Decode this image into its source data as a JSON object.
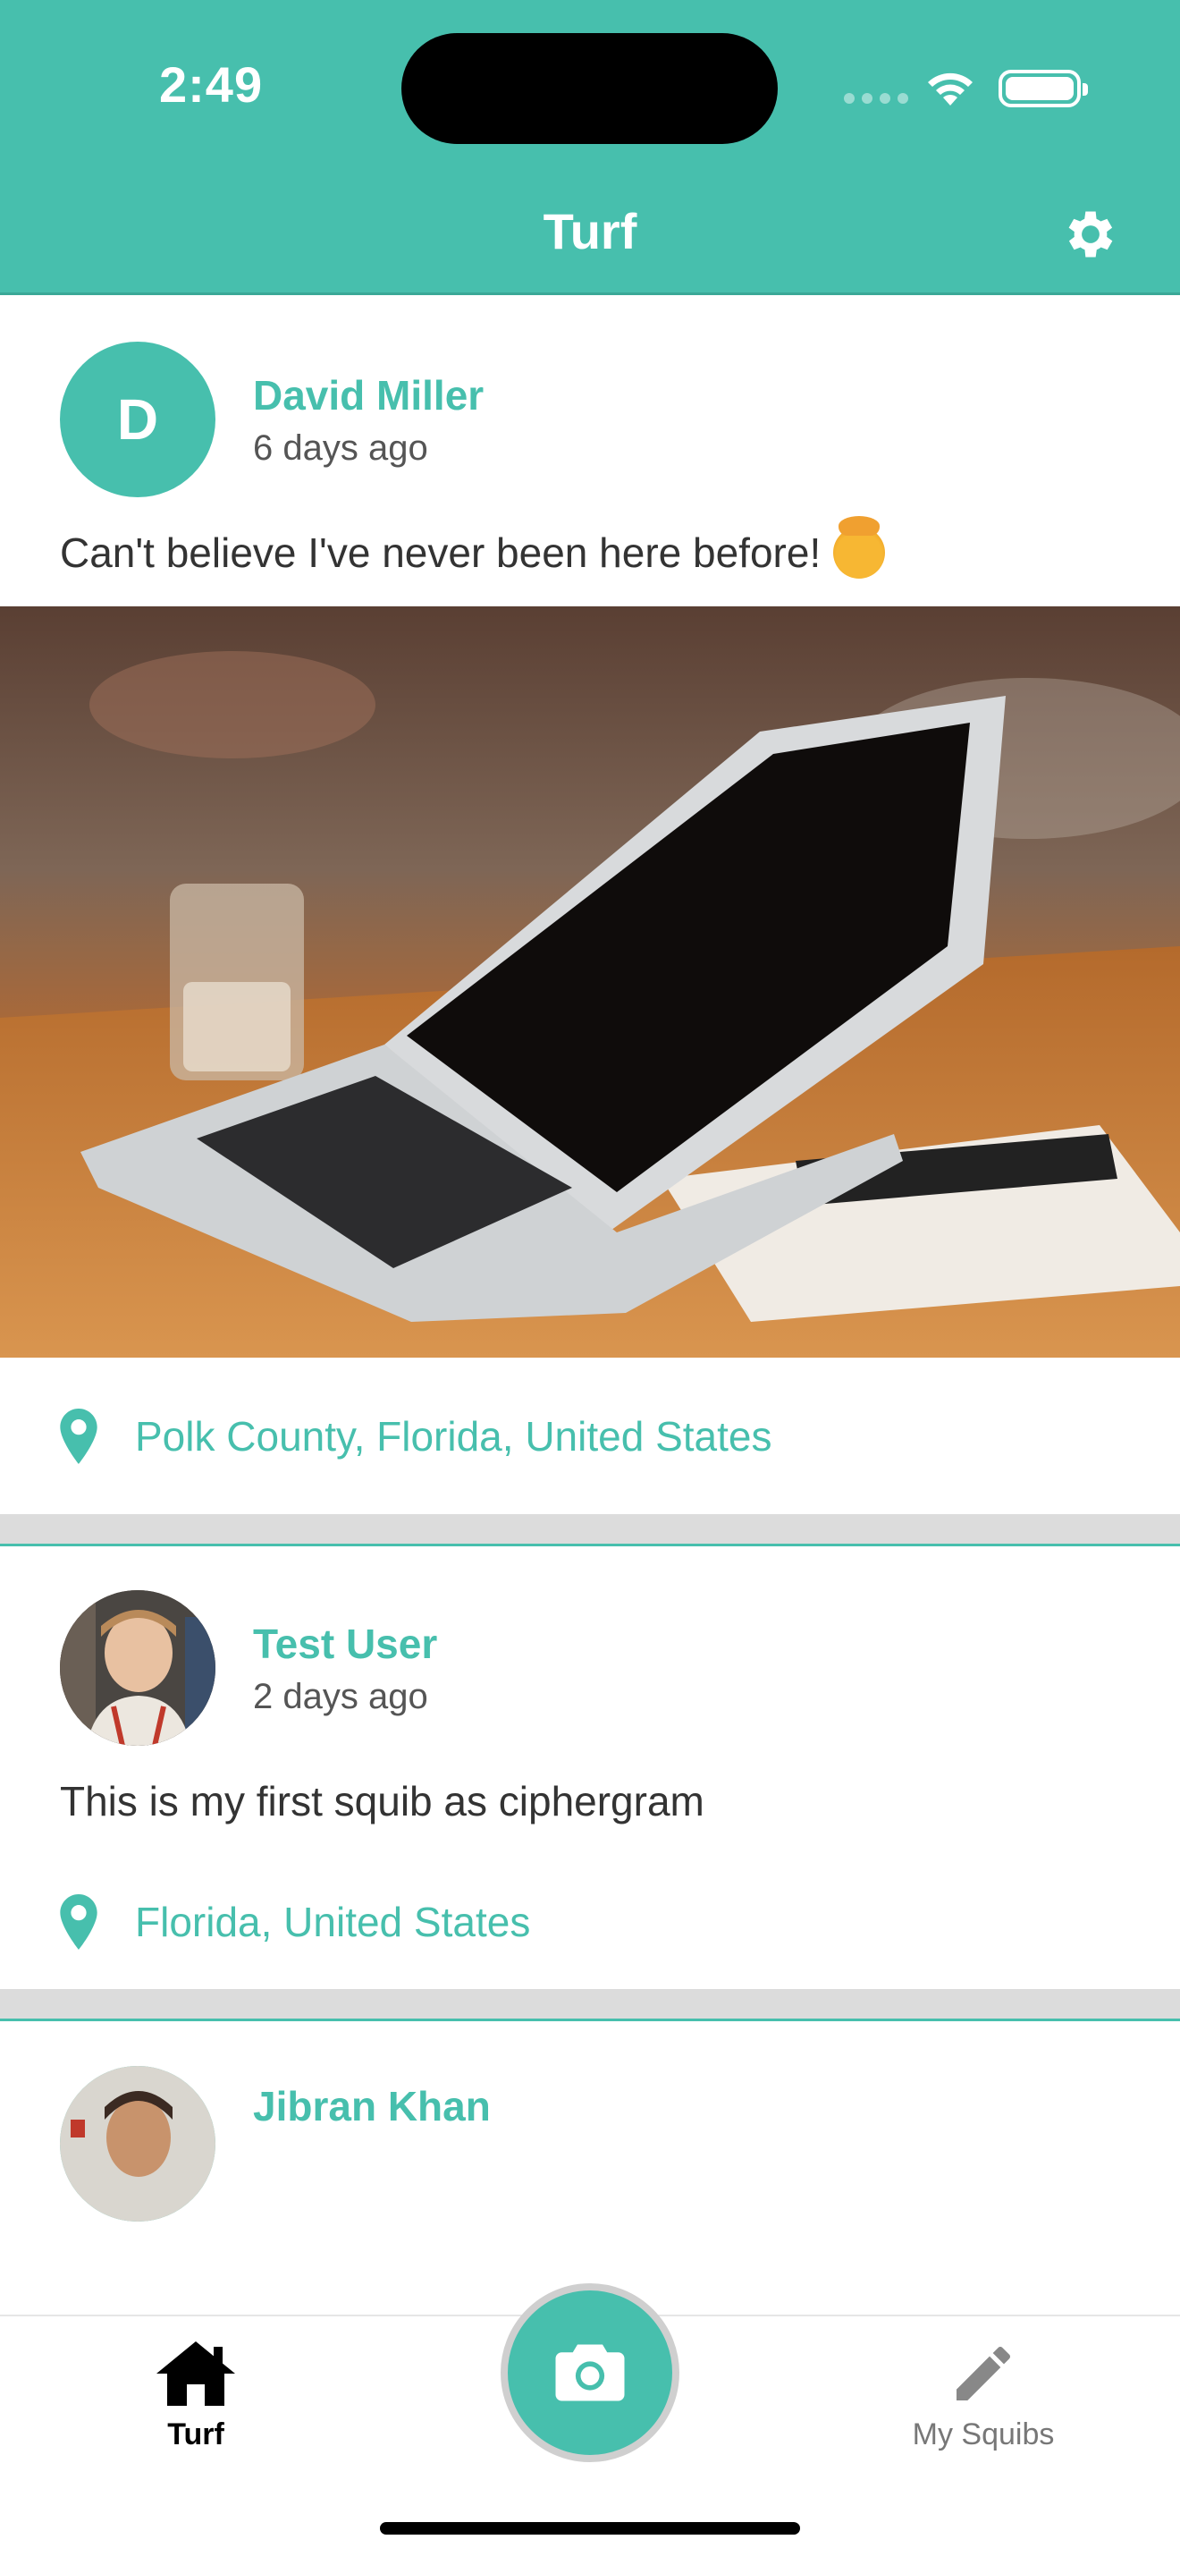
{
  "status_bar": {
    "time": "2:49"
  },
  "nav": {
    "title": "Turf"
  },
  "posts": [
    {
      "author": "David Miller",
      "avatar_initial": "D",
      "time_ago": "6 days ago",
      "text": "Can't believe I've never been here before!",
      "emoji": "exploding-head",
      "has_image": true,
      "location": "Polk County, Florida, United States"
    },
    {
      "author": "Test User",
      "avatar_initial": "",
      "time_ago": "2 days ago",
      "text": "This is my first squib as ciphergram",
      "has_image": false,
      "location": "Florida, United States"
    },
    {
      "author": "Jibran Khan",
      "avatar_initial": "",
      "time_ago": "",
      "text": ""
    }
  ],
  "tabs": {
    "turf": "Turf",
    "my_squibs": "My Squibs"
  },
  "colors": {
    "accent": "#47bfad",
    "inactive_tab": "#777777",
    "divider": "#dcdcdc"
  }
}
